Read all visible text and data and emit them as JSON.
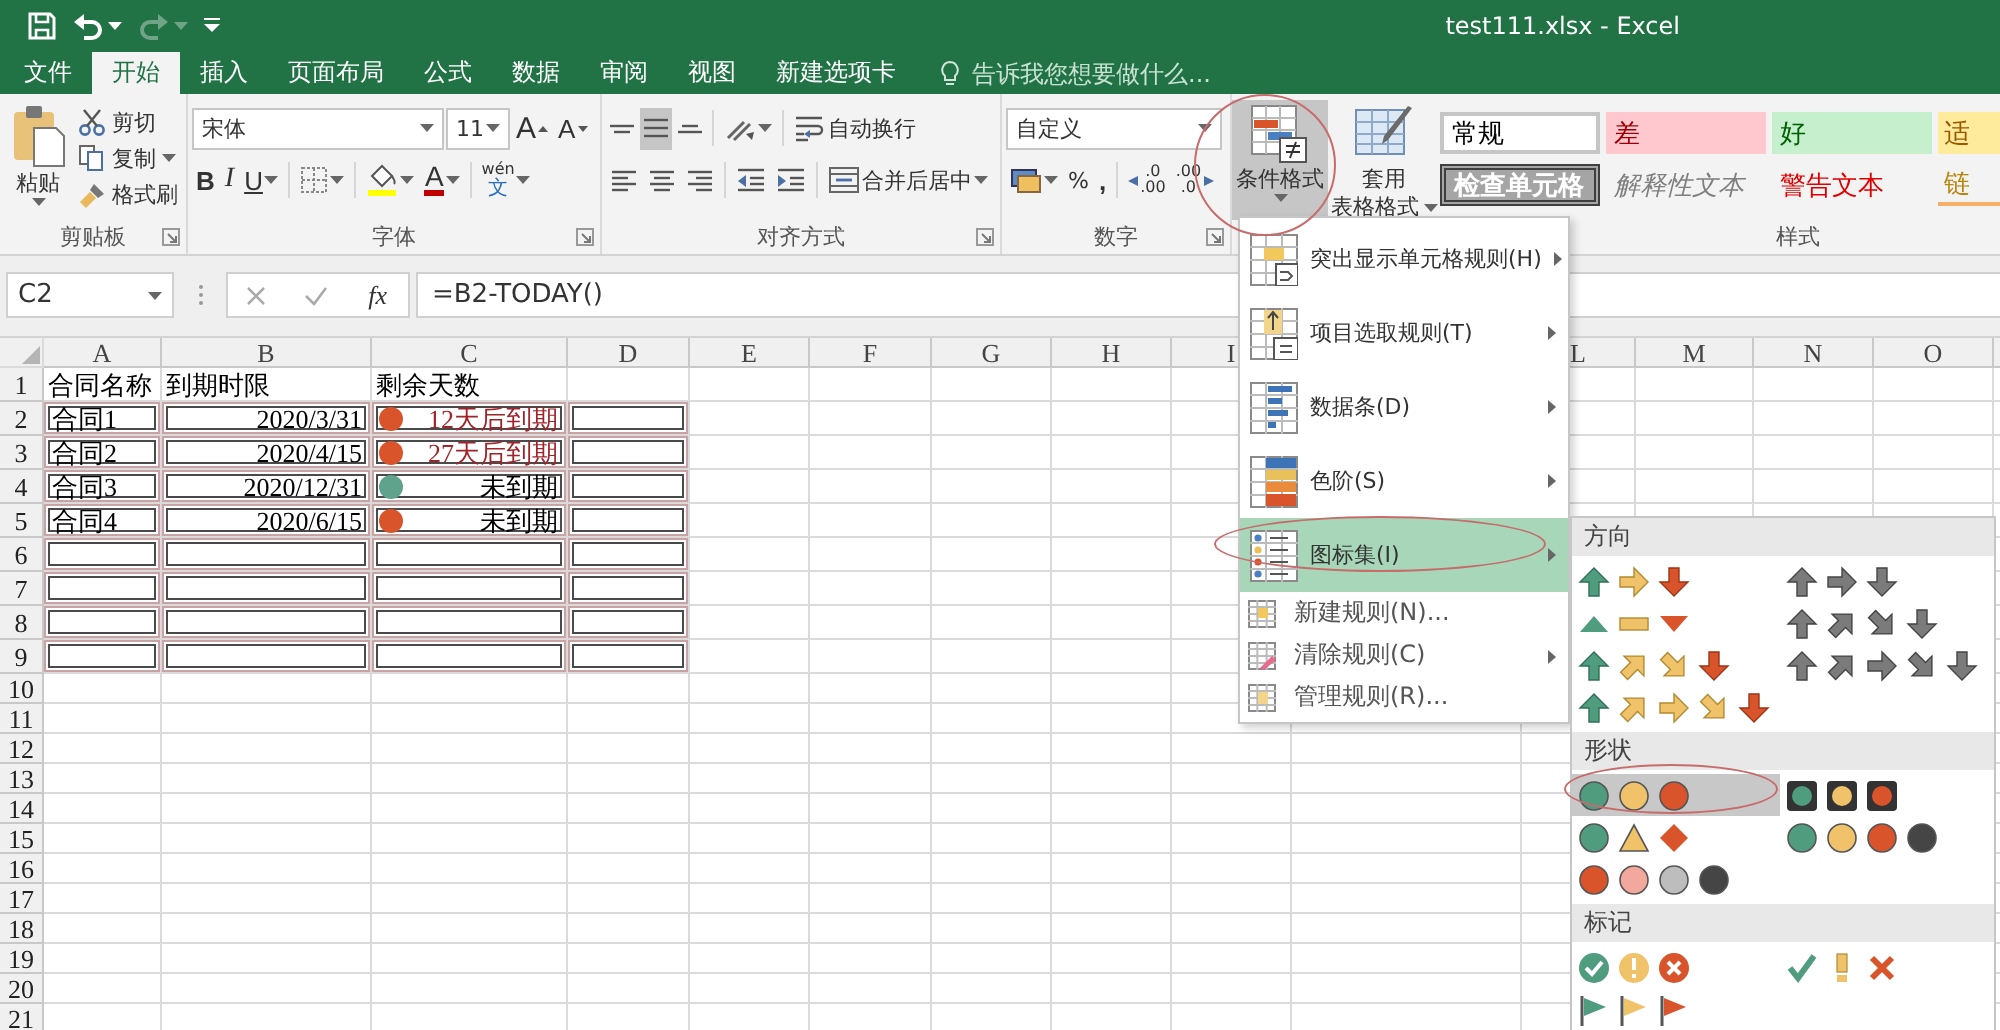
{
  "title_bar": {
    "title": "test111.xlsx - Excel",
    "redo": {
      "disabled": true
    }
  },
  "tabs": [
    {
      "label": "文件",
      "selected": false
    },
    {
      "label": "开始",
      "selected": true
    },
    {
      "label": "插入",
      "selected": false
    },
    {
      "label": "页面布局",
      "selected": false
    },
    {
      "label": "公式",
      "selected": false
    },
    {
      "label": "数据",
      "selected": false
    },
    {
      "label": "审阅",
      "selected": false
    },
    {
      "label": "视图",
      "selected": false
    },
    {
      "label": "新建选项卡",
      "selected": false
    }
  ],
  "tell_me": {
    "placeholder": "告诉我您想要做什么..."
  },
  "ribbon": {
    "clipboard": {
      "paste": "粘贴",
      "cut": "剪切",
      "copy": "复制",
      "format_painter": "格式刷",
      "label": "剪贴板"
    },
    "font": {
      "font_name": "宋体",
      "font_size": "11",
      "grow_font": "A",
      "shrink_font": "A",
      "bold": "B",
      "italic": "I",
      "underline": "U",
      "font_color": "A",
      "phonetic": [
        "wén",
        "文"
      ],
      "label": "字体"
    },
    "alignment": {
      "vertical": [
        {
          "selected": false
        },
        {
          "selected": true
        },
        {
          "selected": false
        }
      ],
      "wrap_text": "自动换行",
      "merge_center": "合并后居中",
      "label": "对齐方式"
    },
    "number": {
      "format": "自定义",
      "percent": "%",
      "comma": ",",
      "increase_decimal": [
        ".0",
        ".00"
      ],
      "decrease_decimal": [
        ".00",
        ".0"
      ],
      "label": "数字"
    },
    "styles": {
      "conditional_formatting": {
        "label": "条件格式",
        "expanded": true
      },
      "format_as_table": [
        "套用",
        "表格格式"
      ],
      "gallery": [
        {
          "kind": "normal",
          "label": "常规"
        },
        {
          "kind": "bad",
          "label": "差"
        },
        {
          "kind": "good",
          "label": "好"
        },
        {
          "kind": "neutral",
          "label": "适"
        },
        {
          "kind": "check",
          "label": "检查单元格"
        },
        {
          "kind": "explanatory",
          "label": "解释性文本"
        },
        {
          "kind": "warning",
          "label": "警告文本"
        },
        {
          "kind": "linked",
          "label": "链"
        }
      ],
      "label": "样式"
    }
  },
  "formula_bar": {
    "name_box": "C2",
    "fx": "fx",
    "formula": "=B2-TODAY()"
  },
  "sheet": {
    "columns": [
      "A",
      "B",
      "C",
      "D",
      "E",
      "F",
      "G",
      "H",
      "I",
      "L",
      "M",
      "N",
      "O"
    ],
    "rows": [
      {
        "number": "1",
        "kind": "heading",
        "bordered": false,
        "name": "合同名称",
        "due": "到期时限",
        "days": {
          "text": "剩余天数"
        }
      },
      {
        "number": "2",
        "kind": "record",
        "bordered": true,
        "name": "合同1",
        "due": "2020/3/31",
        "days": {
          "text": "12天后到期",
          "alert": true,
          "color": "#d9542b"
        }
      },
      {
        "number": "3",
        "kind": "record",
        "bordered": true,
        "name": "合同2",
        "due": "2020/4/15",
        "days": {
          "text": "27天后到期",
          "alert": true,
          "color": "#d9542b"
        }
      },
      {
        "number": "4",
        "kind": "record",
        "bordered": true,
        "name": "合同3",
        "due": "2020/12/31",
        "days": {
          "text": "未到期",
          "alert": false,
          "color": "#5fa38c"
        }
      },
      {
        "number": "5",
        "kind": "record",
        "bordered": true,
        "name": "合同4",
        "due": "2020/6/15",
        "days": {
          "text": "未到期",
          "alert": false,
          "color": "#d9542b"
        }
      },
      {
        "number": "6",
        "kind": "empty",
        "bordered": true
      },
      {
        "number": "7",
        "kind": "empty",
        "bordered": true
      },
      {
        "number": "8",
        "kind": "empty",
        "bordered": true
      },
      {
        "number": "9",
        "kind": "empty",
        "bordered": true
      },
      {
        "number": "10",
        "kind": "empty",
        "bordered": false
      },
      {
        "number": "11",
        "kind": "empty",
        "bordered": false
      },
      {
        "number": "12",
        "kind": "empty",
        "bordered": false
      },
      {
        "number": "13",
        "kind": "empty",
        "bordered": false
      },
      {
        "number": "14",
        "kind": "empty",
        "bordered": false
      },
      {
        "number": "15",
        "kind": "empty",
        "bordered": false
      },
      {
        "number": "16",
        "kind": "empty",
        "bordered": false
      },
      {
        "number": "17",
        "kind": "empty",
        "bordered": false
      },
      {
        "number": "18",
        "kind": "empty",
        "bordered": false
      },
      {
        "number": "19",
        "kind": "empty",
        "bordered": false
      },
      {
        "number": "20",
        "kind": "empty",
        "bordered": false
      },
      {
        "number": "21",
        "kind": "empty",
        "bordered": false
      }
    ]
  },
  "menu": {
    "items": [
      {
        "kind": "large",
        "label": "突出显示单元格规则(H)",
        "submenu": true,
        "selected": false
      },
      {
        "kind": "large",
        "label": "项目选取规则(T)",
        "submenu": true,
        "selected": false
      },
      {
        "kind": "large",
        "label": "数据条(D)",
        "submenu": true,
        "selected": false
      },
      {
        "kind": "large",
        "label": "色阶(S)",
        "submenu": true,
        "selected": false
      },
      {
        "kind": "large",
        "label": "图标集(I)",
        "submenu": true,
        "selected": true
      },
      {
        "kind": "small",
        "label": "新建规则(N)...",
        "submenu": false,
        "selected": false
      },
      {
        "kind": "small",
        "label": "清除规则(C)",
        "submenu": true,
        "selected": false
      },
      {
        "kind": "small",
        "label": "管理规则(R)...",
        "submenu": false,
        "selected": false
      }
    ]
  },
  "icon_sets": {
    "sections": [
      {
        "title": "方向",
        "sets": [
          {
            "selected": false
          },
          {
            "selected": false
          },
          {
            "selected": false
          },
          {
            "selected": false
          },
          {
            "selected": false
          },
          {
            "selected": false
          },
          {
            "selected": false
          }
        ]
      },
      {
        "title": "形状",
        "sets": [
          {
            "selected": true
          },
          {
            "selected": false
          },
          {
            "selected": false
          },
          {
            "selected": false
          },
          {
            "selected": false
          }
        ]
      },
      {
        "title": "标记",
        "sets": [
          {
            "selected": false
          },
          {
            "selected": false
          },
          {
            "selected": false
          }
        ]
      }
    ]
  }
}
